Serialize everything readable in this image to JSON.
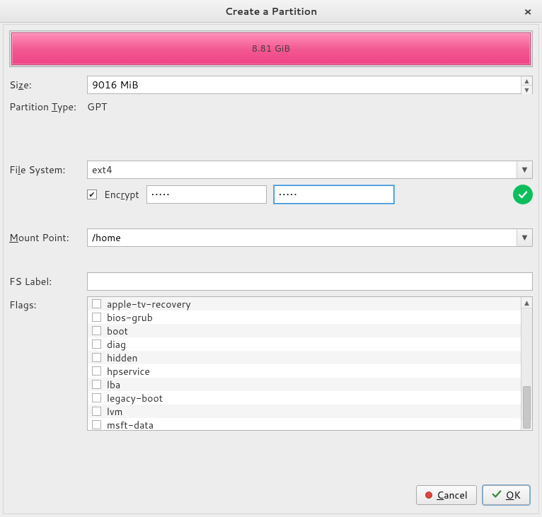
{
  "title": "Create a Partition",
  "bar_label": "8.81 GiB",
  "labels": {
    "size": "Size:",
    "partition_type": "Partition Type:",
    "file_system": "File System:",
    "encrypt": "Encrypt",
    "mount_point": "Mount Point:",
    "fs_label": "FS Label:",
    "flags": "Flags:"
  },
  "underline": {
    "size": "z",
    "partition_type": "T",
    "file_system": "l",
    "encrypt": "r",
    "mount_point": "M",
    "cancel": "C",
    "ok": "O"
  },
  "values": {
    "size": "9016 MiB",
    "partition_type": "GPT",
    "file_system": "ext4",
    "mount_point": "/home",
    "fs_label": "",
    "password1": "•••••",
    "password2": "•••••",
    "encrypt_checked": true
  },
  "flags": [
    "apple-tv-recovery",
    "bios-grub",
    "boot",
    "diag",
    "hidden",
    "hpservice",
    "lba",
    "legacy-boot",
    "lvm",
    "msft-data"
  ],
  "buttons": {
    "cancel": "Cancel",
    "ok": "OK"
  }
}
